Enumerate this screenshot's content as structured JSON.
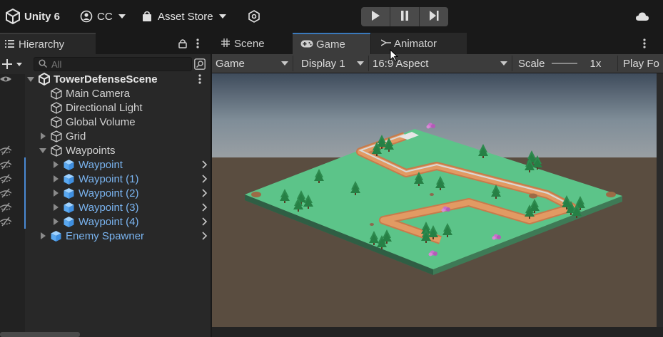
{
  "toolbar": {
    "app_label": "Unity 6",
    "account_label": "CC",
    "asset_store_label": "Asset Store"
  },
  "hierarchy": {
    "tab_label": "Hierarchy",
    "search_placeholder": "All",
    "scene_name": "TowerDefenseScene",
    "items": [
      {
        "label": "Main Camera"
      },
      {
        "label": "Directional Light"
      },
      {
        "label": "Global Volume"
      },
      {
        "label": "Grid"
      },
      {
        "label": "Waypoints"
      },
      {
        "label": "Waypoint"
      },
      {
        "label": "Waypoint (1)"
      },
      {
        "label": "Waypoint (2)"
      },
      {
        "label": "Waypoint (3)"
      },
      {
        "label": "Waypoint (4)"
      },
      {
        "label": "Enemy Spawner"
      }
    ]
  },
  "tabs": {
    "scene": "Scene",
    "game": "Game",
    "animator": "Animator"
  },
  "gamebar": {
    "mode": "Game",
    "display": "Display 1",
    "aspect": "16:9 Aspect",
    "scale_label": "Scale",
    "scale_value": "1x",
    "play_focused": "Play Fo"
  },
  "colors": {
    "accent_blue": "#7ab4f0",
    "selection_bar": "#4a8ad4",
    "grass": "#5cc489",
    "path": "#d98a55"
  }
}
